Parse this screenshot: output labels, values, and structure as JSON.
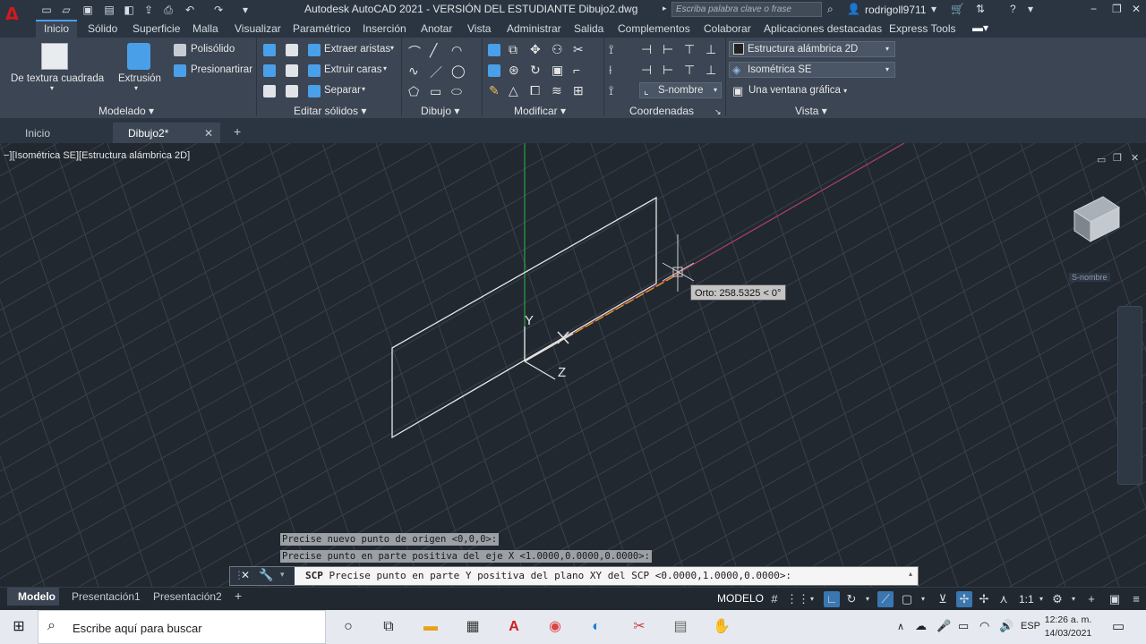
{
  "app": {
    "logo": "A",
    "title": "Autodesk AutoCAD 2021 - VERSIÓN DEL ESTUDIANTE   Dibujo2.dwg",
    "search_placeholder": "Escriba palabra clave o frase",
    "user": "rodrigoll9711"
  },
  "menu_tabs": [
    "Inicio",
    "Sólido",
    "Superficie",
    "Malla",
    "Visualizar",
    "Paramétrico",
    "Inserción",
    "Anotar",
    "Vista",
    "Administrar",
    "Salida",
    "Complementos",
    "Colaborar",
    "Aplicaciones destacadas",
    "Express Tools"
  ],
  "ribbon": {
    "panels": [
      "Modelado",
      "Editar sólidos",
      "Dibujo",
      "Modificar",
      "Coordenadas",
      "Vista"
    ],
    "modelado": {
      "box": "De textura cuadrada",
      "extrude": "Extrusión",
      "polysolid": "Polisólido",
      "presspull": "Presionartirar"
    },
    "editar": {
      "extract_edges": "Extraer aristas",
      "extrude_faces": "Extruir caras",
      "separate": "Separar"
    },
    "coord": {
      "named": "S-nombre"
    },
    "vista": {
      "visual_style": "Estructura alámbrica 2D",
      "view": "Isométrica SE",
      "viewport": "Una ventana gráfica"
    }
  },
  "doc_tabs": {
    "start": "Inicio",
    "current": "Dibujo2*"
  },
  "viewport": {
    "label": "−][Isométrica SE][Estructura alámbrica 2D]",
    "tooltip": "Orto: 258.5325 < 0°",
    "axis_y": "Y",
    "axis_z": "Z",
    "viewcube_named": "S-nombre"
  },
  "command": {
    "history": [
      "Precise nuevo punto de origen <0,0,0>:",
      "Precise punto en parte positiva del eje X <1.0000,0.0000,0.0000>:"
    ],
    "prompt_cmd": "SCP",
    "prompt": "Precise punto en parte Y positiva del plano XY del SCP <0.0000,1.0000,0.0000>:"
  },
  "layout_tabs": [
    "Modelo",
    "Presentación1",
    "Presentación2"
  ],
  "status": {
    "space": "MODELO",
    "scale": "1:1"
  },
  "taskbar": {
    "search": "Escribe aquí para buscar",
    "lang": "ESP",
    "time": "12:26 a. m.",
    "date": "14/03/2021"
  },
  "colors": {
    "accent": "#4aa0e8",
    "logo_red": "#d21b1b",
    "x_axis": "#b04060",
    "y_axis": "#2ea043",
    "track": "#d9a01a"
  }
}
